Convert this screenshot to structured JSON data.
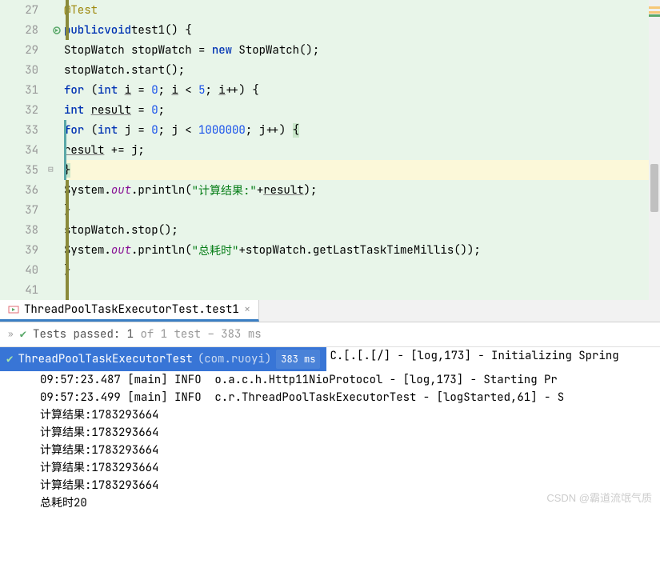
{
  "gutter": {
    "lines": [
      27,
      28,
      29,
      30,
      31,
      32,
      33,
      34,
      35,
      36,
      37,
      38,
      39,
      40,
      41
    ]
  },
  "code": {
    "l27": {
      "ann": "@Test"
    },
    "l28": {
      "kw1": "public",
      "kw2": "void",
      "name": "test1",
      "paren": "() {"
    },
    "l29": {
      "type1": "StopWatch",
      "var": " stopWatch = ",
      "kw": "new",
      "type2": " StopWatch();"
    },
    "l30": {
      "text": "stopWatch.start();"
    },
    "l31": {
      "kw1": "for",
      "p1": " (",
      "kw2": "int",
      "v1": " ",
      "u1": "i",
      "eq": " = ",
      "n1": "0",
      "semi1": "; ",
      "u2": "i",
      "lt": " < ",
      "n2": "5",
      "semi2": "; ",
      "u3": "i",
      "inc": "++) {"
    },
    "l32": {
      "kw": "int",
      "sp": " ",
      "u": "result",
      "rest": " = ",
      "n": "0",
      "end": ";"
    },
    "l33": {
      "kw1": "for",
      "p1": " (",
      "kw2": "int",
      "sp1": " j = ",
      "n1": "0",
      "semi1": "; j < ",
      "n2": "1000000",
      "semi2": "; j++) ",
      "brace": "{"
    },
    "l34": {
      "u": "result",
      "rest": " += j;"
    },
    "l35": {
      "brace": "}"
    },
    "l36": {
      "sys": "System.",
      "out": "out",
      "dot": ".println(",
      "str": "\"计算结果:\"",
      "plus": "+",
      "u": "result",
      "end": ");"
    },
    "l37": {
      "brace": "}"
    },
    "l38": {
      "text": "stopWatch.stop();"
    },
    "l39": {
      "sys": "System.",
      "out": "out",
      "dot": ".println(",
      "str": "\"总耗时\"",
      "rest": "+stopWatch.getLastTaskTimeMillis());"
    },
    "l40": {
      "brace": "}"
    }
  },
  "tab": {
    "label": "ThreadPoolTaskExecutorTest.test1"
  },
  "testStatus": {
    "prefix": "Tests passed: 1",
    "suffix": " of 1 test – 383 ms"
  },
  "testNode": {
    "name": "ThreadPoolTaskExecutorTest",
    "pkg": " (com.ruoyi)",
    "time": "383 ms"
  },
  "console": {
    "l0": "C.[.[.[/] - [log,173] - Initializing Spring ",
    "l1": "09:57:23.487 [main] INFO  o.a.c.h.Http11NioProtocol - [log,173] - Starting Pr",
    "l2": "09:57:23.499 [main] INFO  c.r.ThreadPoolTaskExecutorTest - [logStarted,61] - S",
    "l3": "计算结果:1783293664",
    "l4": "计算结果:1783293664",
    "l5": "计算结果:1783293664",
    "l6": "计算结果:1783293664",
    "l7": "计算结果:1783293664",
    "l8": "总耗时20"
  },
  "watermark": "CSDN @霸道流氓气质"
}
